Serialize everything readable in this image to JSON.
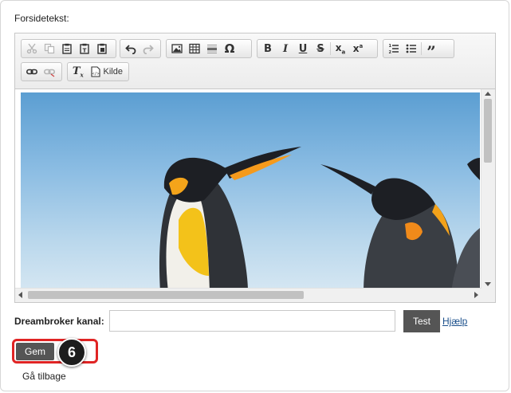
{
  "form": {
    "frontpage_label": "Forsidetekst:",
    "dreambroker_label": "Dreambroker kanal:",
    "dreambroker_value": "",
    "dreambroker_placeholder": "",
    "test_label": "Test",
    "help_label": "Hjælp",
    "save_label": "Gem",
    "back_label": "Gå tilbage"
  },
  "toolbar": {
    "source_label": "Kilde"
  },
  "annotation": {
    "step_number": "6"
  },
  "colors": {
    "highlight": "#e02424",
    "button_bg": "#555555",
    "link": "#1a4f8b"
  }
}
